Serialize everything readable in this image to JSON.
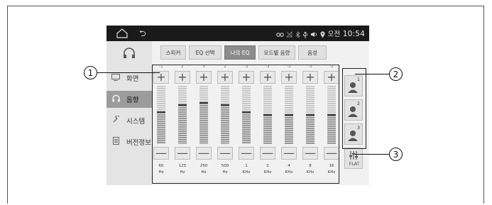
{
  "status_bar": {
    "time_prefix": "오전",
    "time": "10:54",
    "back_glyph": "⮌"
  },
  "sidebar": {
    "items": [
      {
        "label": "화면",
        "icon": "monitor-icon",
        "active": false
      },
      {
        "label": "음향",
        "icon": "headphone-icon",
        "active": true
      },
      {
        "label": "시스템",
        "icon": "wrench-icon",
        "active": false
      },
      {
        "label": "버전정보",
        "icon": "document-icon",
        "active": false
      }
    ]
  },
  "tabs": [
    {
      "label": "스피커",
      "active": false
    },
    {
      "label": "EQ 선택",
      "active": false
    },
    {
      "label": "나의 EQ",
      "active": true
    },
    {
      "label": "모드별 음량",
      "active": false
    },
    {
      "label": "음성",
      "active": false
    }
  ],
  "eq": {
    "bands": [
      {
        "value": "-1",
        "freq": "60",
        "unit": "Hz",
        "level": 0.55
      },
      {
        "value": "2",
        "freq": "125",
        "unit": "Hz",
        "level": 0.67
      },
      {
        "value": "3",
        "freq": "250",
        "unit": "Hz",
        "level": 0.71
      },
      {
        "value": "2",
        "freq": "500",
        "unit": "Hz",
        "level": 0.67
      },
      {
        "value": "-1",
        "freq": "1",
        "unit": "KHz",
        "level": 0.55
      },
      {
        "value": "-2",
        "freq": "2",
        "unit": "KHz",
        "level": 0.5
      },
      {
        "value": "-2",
        "freq": "4",
        "unit": "KHz",
        "level": 0.5
      },
      {
        "value": "-2",
        "freq": "8",
        "unit": "KHz",
        "level": 0.5
      },
      {
        "value": "-2",
        "freq": "16",
        "unit": "KHz",
        "level": 0.5
      }
    ],
    "plus_glyph": "+",
    "minus_glyph": "—"
  },
  "presets": [
    {
      "label": "1",
      "icon": "user-preset-icon"
    },
    {
      "label": "2",
      "icon": "user-preset-icon"
    },
    {
      "label": "3",
      "icon": "user-preset-icon"
    }
  ],
  "flat": {
    "label": "FLAT",
    "icon": "equalizer-sliders-icon"
  },
  "callouts": {
    "c1": "1",
    "c2": "2",
    "c3": "3"
  }
}
